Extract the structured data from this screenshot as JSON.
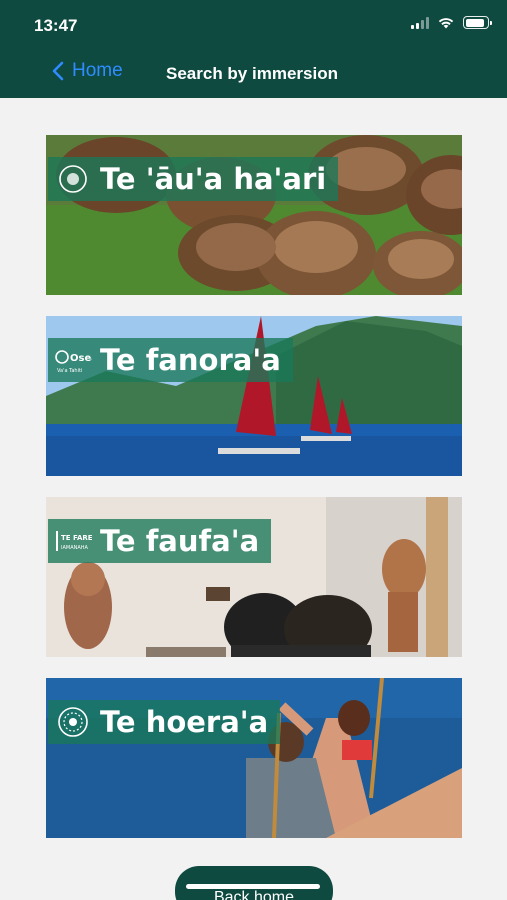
{
  "status_bar": {
    "time": "13:47",
    "battery_level": 0.9
  },
  "nav": {
    "back_label": "Home",
    "title": "Search by immersion"
  },
  "cards": [
    {
      "label": "Te 'āu'a ha'ari",
      "logo": "coconut-circle-logo"
    },
    {
      "label": "Te fanora'a",
      "logo": "osea-logo",
      "logo_text": "Osea",
      "logo_subtext": "Va'a Tahiti"
    },
    {
      "label": "Te faufa'a",
      "logo": "te-fare-iamanaha-logo",
      "logo_text": "TE FARE",
      "logo_subtext": "IAMANAHA"
    },
    {
      "label": "Te hoera'a",
      "logo": "round-emblem-logo"
    }
  ],
  "footer": {
    "back_home_label": "Back home"
  },
  "colors": {
    "header_bg": "#0e4a40",
    "link_blue": "#2f8cff",
    "label_bg": "#19785a"
  }
}
